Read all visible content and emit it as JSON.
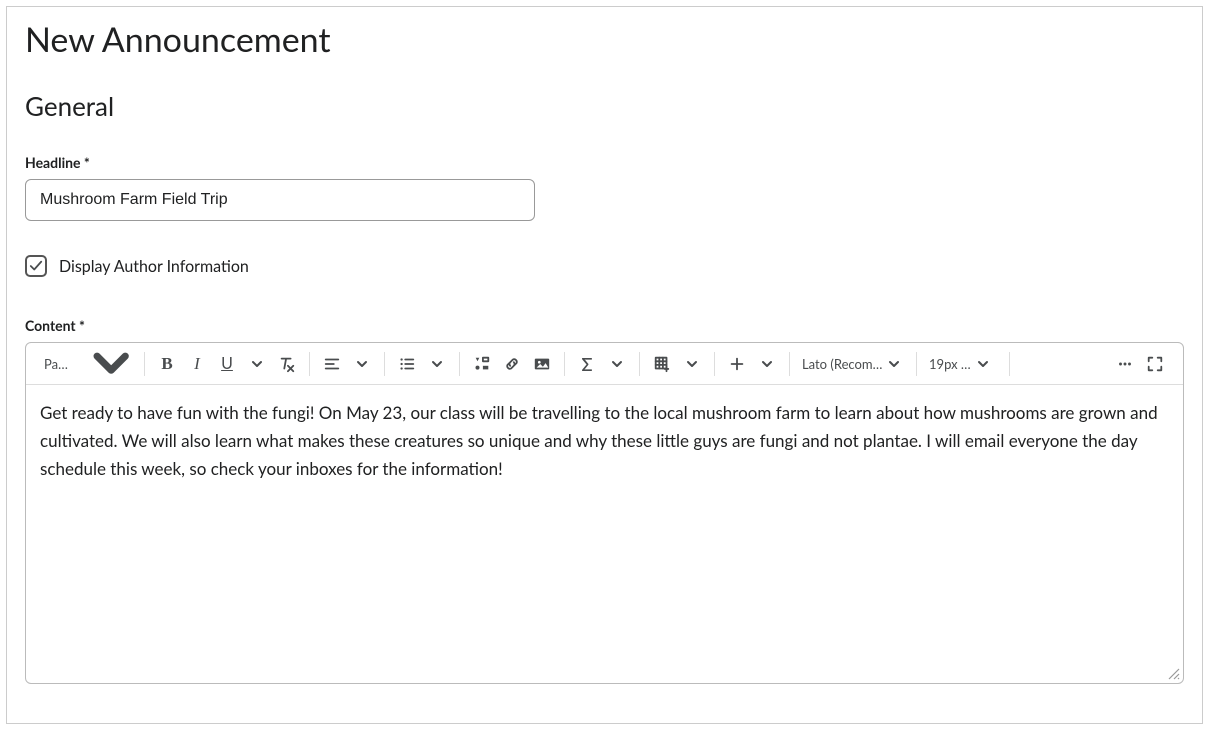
{
  "page": {
    "title": "New Announcement",
    "section": "General"
  },
  "headline": {
    "label": "Headline *",
    "value": "Mushroom Farm Field Trip"
  },
  "author_checkbox": {
    "label": "Display Author Information",
    "checked": true
  },
  "content": {
    "label": "Content *",
    "body": "Get ready to have fun with the fungi! On May 23, our class will be travelling to the local mushroom farm to learn about how mushrooms are grown and cultivated. We will also learn what makes these creatures so unique and why these little guys are fungi and not plantae. I will email everyone the day schedule this week, so check your inboxes for the information!"
  },
  "toolbar": {
    "paragraph_style": "Paragraph",
    "font_family": "Lato (Recom…",
    "font_size": "19px …"
  }
}
